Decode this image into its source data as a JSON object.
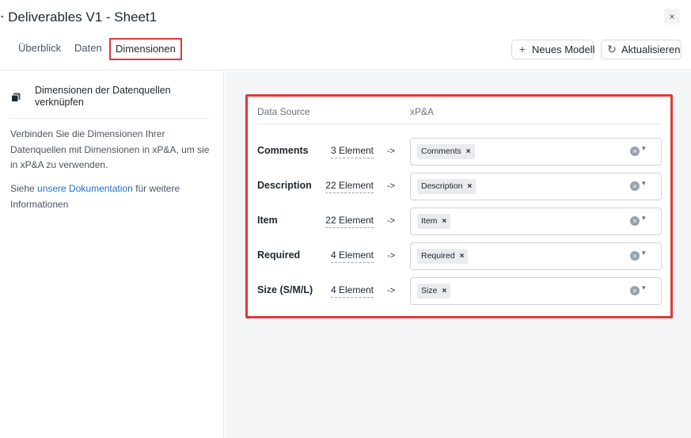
{
  "window": {
    "title": "‧ Deliverables V1 - Sheet1",
    "close_label": "×"
  },
  "tabs": [
    {
      "label": "Überblick"
    },
    {
      "label": "Daten"
    },
    {
      "label": "Dimensionen"
    }
  ],
  "header_buttons": {
    "new_model": {
      "label": "Neues Modell",
      "icon": "plus-icon"
    },
    "refresh": {
      "label": "Aktualisieren",
      "icon": "refresh-icon"
    }
  },
  "sidebar": {
    "title": "Dimensionen der Datenquellen verknüpfen",
    "icon": "layers-icon",
    "description": "Verbinden Sie die Dimensionen Ihrer Datenquellen mit Dimensionen in xP&A, um sie in xP&A zu verwenden.",
    "link_prefix": "Siehe ",
    "link_text": "unsere Dokumentation",
    "link_suffix": " für weitere Informationen"
  },
  "mapping": {
    "col_source": "Data Source",
    "col_target": "xP&A",
    "arrow": "->",
    "rows": [
      {
        "label": "Comments",
        "count": "3 Element",
        "chip": "Comments"
      },
      {
        "label": "Description",
        "count": "22 Element",
        "chip": "Description"
      },
      {
        "label": "Item",
        "count": "22 Element",
        "chip": "Item"
      },
      {
        "label": "Required",
        "count": "4 Element",
        "chip": "Required"
      },
      {
        "label": "Size (S/M/L)",
        "count": "4 Element",
        "chip": "Size"
      }
    ]
  },
  "colors": {
    "highlight": "#e0383a",
    "link": "#1f6fd1",
    "background": "#f4f5f7"
  }
}
